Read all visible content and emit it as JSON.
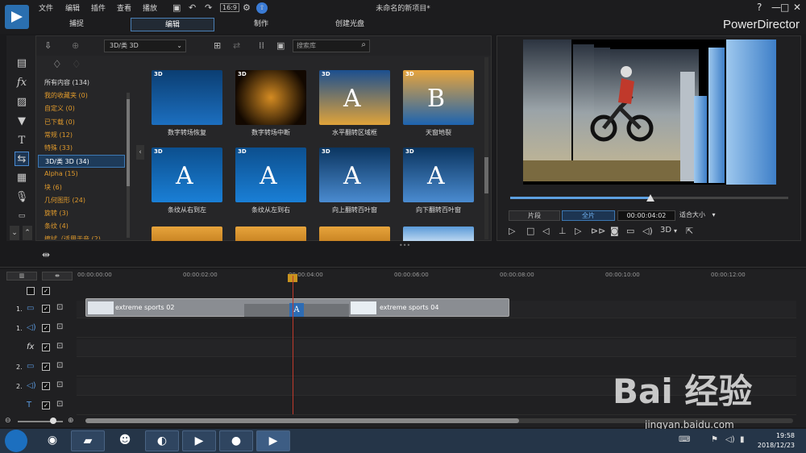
{
  "app": {
    "title": "未命名的新项目*",
    "brand": "PowerDirector",
    "menu": [
      "文件",
      "编辑",
      "插件",
      "查看",
      "播放"
    ],
    "modes": [
      "捕捉",
      "编辑",
      "制作",
      "创建光盘"
    ],
    "window_controls": [
      "?",
      "—",
      "□",
      "✕"
    ]
  },
  "library": {
    "dropdown": "3D/类 3D",
    "search_placeholder": "搜索库",
    "categories": [
      {
        "label": "所有内容 (134)",
        "style": "white"
      },
      {
        "label": "我的收藏夹 (0)",
        "style": "orange"
      },
      {
        "label": "自定义 (0)",
        "style": "orange"
      },
      {
        "label": "已下载 (0)",
        "style": "orange"
      },
      {
        "label": "常规 (12)",
        "style": "orange"
      },
      {
        "label": "特殊 (33)",
        "style": "orange"
      },
      {
        "label": "3D/类 3D (34)",
        "style": "selected"
      },
      {
        "label": "Alpha (15)",
        "style": "orange"
      },
      {
        "label": "块 (6)",
        "style": "orange"
      },
      {
        "label": "几何图形 (24)",
        "style": "orange"
      },
      {
        "label": "旋转 (3)",
        "style": "orange"
      },
      {
        "label": "条纹 (4)",
        "style": "orange"
      },
      {
        "label": "擦拭（适用于音 (2)",
        "style": "orange"
      }
    ],
    "items": [
      {
        "label": "数字转场恢复",
        "badge": "3D"
      },
      {
        "label": "数字转场中断",
        "badge": "3D"
      },
      {
        "label": "水平翻转区域框",
        "badge": "3D"
      },
      {
        "label": "天窗地裂",
        "badge": "3D"
      },
      {
        "label": "条纹从右到左",
        "badge": "3D"
      },
      {
        "label": "条纹从左到右",
        "badge": "3D"
      },
      {
        "label": "向上翻转百叶窗",
        "badge": "3D"
      },
      {
        "label": "向下翻转百叶窗",
        "badge": "3D"
      }
    ]
  },
  "preview": {
    "segment_label": "片段",
    "full_label": "全片",
    "timecode": "00:00:04:02",
    "fit_label": "适合大小",
    "mode_3d": "3D",
    "seek_fraction": 0.5
  },
  "timeline": {
    "ruler_ticks": [
      "00:00:00:00",
      "00:00:02:00",
      "00:00:04:00",
      "00:00:06:00",
      "00:00:08:00",
      "00:00:10:00",
      "00:00:12:00"
    ],
    "tracks": [
      {
        "number": "1.",
        "type": "video-icon"
      },
      {
        "number": "1.",
        "type": "audio-icon"
      },
      {
        "number": "",
        "type": "fx-icon"
      },
      {
        "number": "2.",
        "type": "video-icon"
      },
      {
        "number": "2.",
        "type": "audio-icon"
      },
      {
        "number": "",
        "type": "title-icon"
      }
    ],
    "clips": [
      {
        "label": "extreme sports 02"
      },
      {
        "label": "extreme sports 04"
      }
    ]
  },
  "taskbar": {
    "time": "19:58",
    "date": "2018/12/23"
  },
  "watermark": {
    "text": "Bai 经验",
    "url": "jingyan.baidu.com"
  }
}
